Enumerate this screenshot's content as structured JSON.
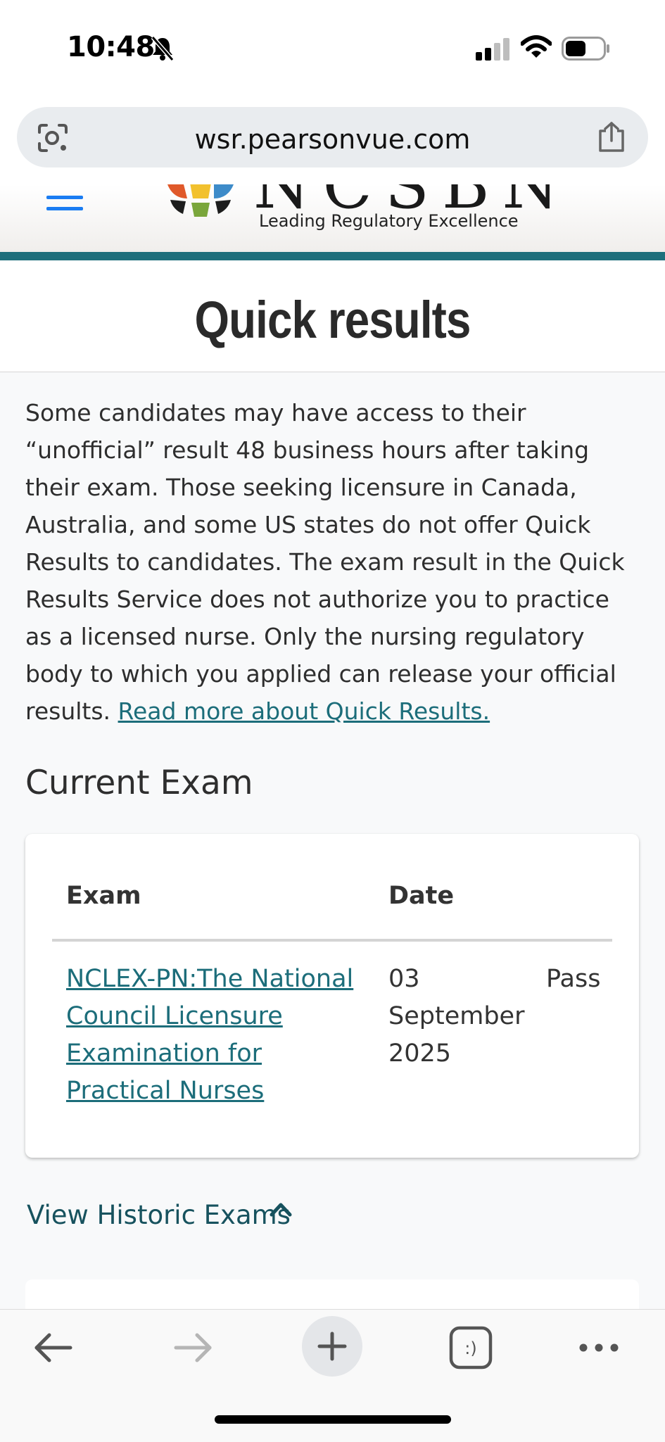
{
  "status_bar": {
    "time": "10:48",
    "icons": [
      "bell-slash-icon",
      "signal-icon",
      "wifi-icon",
      "battery-icon"
    ]
  },
  "browser": {
    "url": "wsr.pearsonvue.com",
    "icons": [
      "lens-icon",
      "share-icon"
    ]
  },
  "site_header": {
    "logo_text": "NCSBN",
    "tagline": "Leading Regulatory Excellence"
  },
  "page": {
    "title": "Quick results",
    "intro_text": "Some candidates may have access to their “unofficial” result 48 business hours after taking their exam. Those seeking licensure in Canada, Australia, and some US states do not offer Quick Results to candidates.  The exam result in the Quick Results Service does not authorize you to practice as a licensed nurse. Only the nursing regulatory body to which you applied can release your official results.",
    "read_more_link": "Read more about Quick Results."
  },
  "current_exam": {
    "heading": "Current Exam",
    "columns": [
      "Exam",
      "Date"
    ],
    "rows": [
      {
        "exam": "NCLEX-PN:The National Council Licensure Examination for Practical Nurses",
        "date": "03 September 2025",
        "result": "Pass"
      }
    ]
  },
  "historic": {
    "label": "View Historic Exams"
  },
  "toolbar": {
    "icons": [
      "back-icon",
      "forward-icon",
      "new-tab-icon",
      "tabs-icon",
      "more-icon"
    ],
    "tabs_glyph": ":)"
  },
  "colors": {
    "teal": "#1f6f7c",
    "link": "#1c6d7a",
    "ios_blue": "#1a7cf2"
  }
}
